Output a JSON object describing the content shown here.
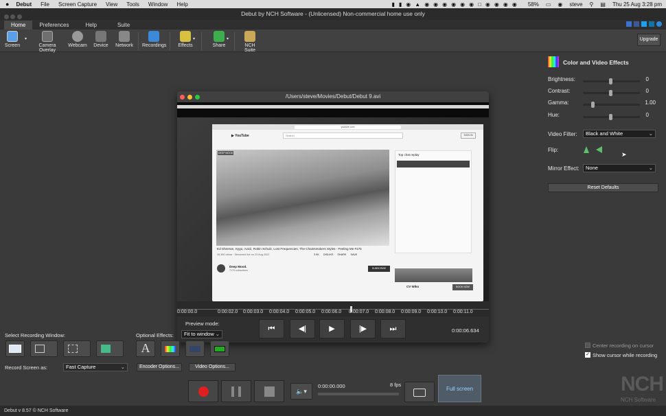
{
  "menubar": {
    "app": "Debut",
    "items": [
      "File",
      "Screen Capture",
      "View",
      "Tools",
      "Window",
      "Help"
    ],
    "battery": "58%",
    "user": "steve",
    "clock": "Thu 25 Aug  3:28 pm"
  },
  "window": {
    "title": "Debut by NCH Software - (Unlicensed) Non-commercial home use only"
  },
  "tabs": [
    "Home",
    "Preferences",
    "Help",
    "Suite"
  ],
  "toolbar": {
    "screen": "Screen",
    "camera_overlay": "Camera Overlay",
    "webcam": "Webcam",
    "device": "Device",
    "network": "Network",
    "recordings": "Recordings",
    "effects": "Effects",
    "share": "Share",
    "nch_suite": "NCH Suite",
    "upgrade": "Upgrade"
  },
  "effects_panel": {
    "title": "Color and Video Effects",
    "brightness_label": "Brightness:",
    "brightness": "0",
    "contrast_label": "Contrast:",
    "contrast": "0",
    "gamma_label": "Gamma:",
    "gamma": "1.00",
    "hue_label": "Hue:",
    "hue": "0",
    "video_filter_label": "Video Filter:",
    "video_filter": "Black and White",
    "flip_label": "Flip:",
    "mirror_label": "Mirror Effect:",
    "mirror": "None",
    "reset": "Reset Defaults"
  },
  "preview": {
    "title": "/Users/steve/Movies/Debut/Debut 9.avi",
    "ticks": [
      "0:00:00.0",
      "0:00:02.0",
      "0:00:03.0",
      "0:00:04.0",
      "0:00:05.0",
      "0:00:06.0",
      "0:00:07.0",
      "0:00:08.0",
      "0:00:09.0",
      "0:00:10.0",
      "0:00:11.0"
    ],
    "preview_mode_label": "Preview mode:",
    "preview_mode": "Fit to window",
    "time": "0:00:06.634",
    "yt": {
      "url": "youtube.com",
      "search": "Search",
      "sign_in": "SIGN IN",
      "title": "Ed Sheeran, Kygo, Avicii, Robin Schulz, Lost Frequencies, The Chainsmokers Styles - Feeling Me #175",
      "views": "26,380 views · Streamed live on 24 Aug 2022",
      "likes": "3.9K",
      "dislike": "DISLIKE",
      "share": "SHARE",
      "save": "SAVE",
      "channel": "Deep Mood.",
      "subs": "717K subscribers",
      "subscribe": "SUBSCRIBE",
      "chat_title": "Top chat replay",
      "ad": "CV Wiko",
      "book": "BOOK NOW",
      "deep_mood_tag": "DEEP MOOD"
    }
  },
  "bottom": {
    "select_window_label": "Select Recording Window:",
    "optional_effects_label": "Optional Effects:",
    "record_as_label": "Record Screen as:",
    "record_as": "Fast Capture",
    "encoder": "Encoder Options...",
    "video_opts": "Video Options...",
    "rec_time": "0:00:00.000",
    "fps": "8 fps",
    "full_screen": "Full screen",
    "center_cursor": "Center recording on cursor",
    "show_cursor": "Show cursor while recording"
  },
  "status": "Debut v 8.57 © NCH Software",
  "brand": {
    "logo": "NCH",
    "sub": "NCH Software"
  }
}
